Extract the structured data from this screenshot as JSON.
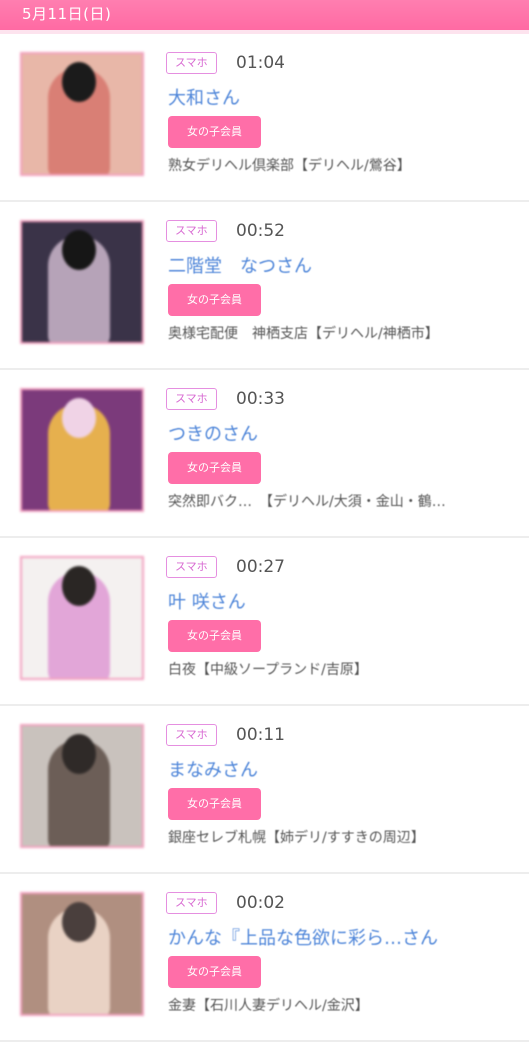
{
  "date_label": "5月11日(日)",
  "badge_label": "スマホ",
  "tag_label": "女の子会員",
  "items": [
    {
      "time": "01:04",
      "name": "大和さん",
      "shop": "熟女デリヘル倶楽部【デリヘル/鶯谷】",
      "thumb_colors": [
        "#e8b7a8",
        "#d97f75",
        "#1b1b1b"
      ]
    },
    {
      "time": "00:52",
      "name": "二階堂　なつさん",
      "shop": "奥様宅配便　神栖支店【デリヘル/神栖市】",
      "thumb_colors": [
        "#3a3348",
        "#b6a3b8",
        "#161616"
      ]
    },
    {
      "time": "00:33",
      "name": "つきのさん",
      "shop": "突然即バク…　【デリヘル/大須・金山・鶴…",
      "thumb_colors": [
        "#7b3a7b",
        "#e6b04e",
        "#f0d3e6"
      ]
    },
    {
      "time": "00:27",
      "name": "叶 咲さん",
      "shop": "白夜【中級ソープランド/吉原】",
      "thumb_colors": [
        "#f4f1f0",
        "#e2a6d8",
        "#2a2624"
      ]
    },
    {
      "time": "00:11",
      "name": "まなみさん",
      "shop": "銀座セレブ札幌【姉デリ/すすきの周辺】",
      "thumb_colors": [
        "#c9c2bd",
        "#6c5e57",
        "#2f2a28"
      ]
    },
    {
      "time": "00:02",
      "name": "かんな『上品な色欲に彩ら…さん",
      "shop": "金妻【石川人妻デリヘル/金沢】",
      "thumb_colors": [
        "#b08f80",
        "#e9d2c4",
        "#4a3f3d"
      ]
    }
  ]
}
